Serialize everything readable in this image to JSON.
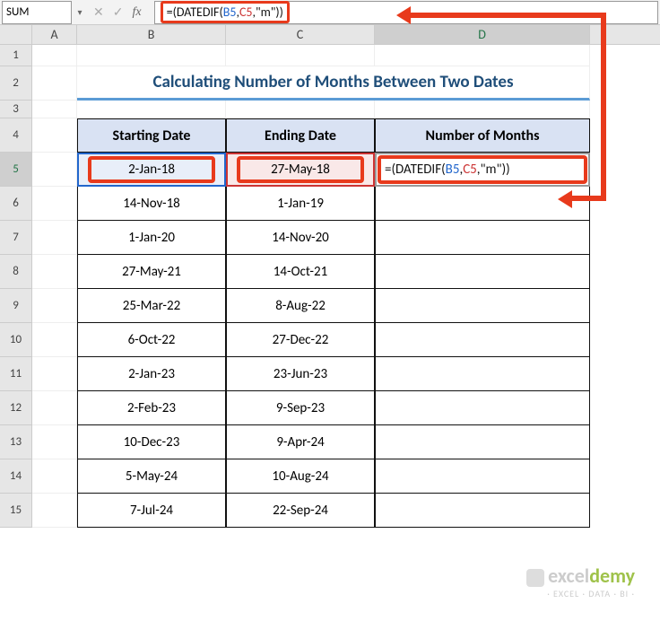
{
  "name_box": "SUM",
  "formula_bar": {
    "eq": "=",
    "p1": "(",
    "fn": "DATEDIF",
    "p2": "(",
    "ref1": "B5",
    "c1": ",",
    "ref2": "C5",
    "c2": ",",
    "str": "\"m\"",
    "p3": ")",
    "p4": ")"
  },
  "columns": [
    "A",
    "B",
    "C",
    "D"
  ],
  "title": "Calculating Number of Months Between Two Dates",
  "headers": {
    "b": "Starting Date",
    "c": "Ending Date",
    "d": "Number of Months"
  },
  "rows": [
    {
      "n": "5",
      "b": "2-Jan-18",
      "c": "27-May-18",
      "d_formula": {
        "eq": "=",
        "p1": "(",
        "fn": "DATEDIF",
        "p2": "(",
        "ref1": "B5",
        "c1": ",",
        "ref2": "C5",
        "c2": ",",
        "str": "\"m\"",
        "p3": ")",
        "p4": ")"
      }
    },
    {
      "n": "6",
      "b": "14-Nov-18",
      "c": "1-Jan-19"
    },
    {
      "n": "7",
      "b": "1-Jan-20",
      "c": "14-Nov-20"
    },
    {
      "n": "8",
      "b": "27-May-21",
      "c": "14-Oct-21"
    },
    {
      "n": "9",
      "b": "25-Mar-22",
      "c": "8-Aug-22"
    },
    {
      "n": "10",
      "b": "6-Oct-22",
      "c": "27-Dec-22"
    },
    {
      "n": "11",
      "b": "2-Jan-23",
      "c": "23-Jun-23"
    },
    {
      "n": "12",
      "b": "2-Feb-23",
      "c": "9-Sep-23"
    },
    {
      "n": "13",
      "b": "10-Dec-23",
      "c": "9-Apr-24"
    },
    {
      "n": "14",
      "b": "5-May-24",
      "c": "10-Aug-24"
    },
    {
      "n": "15",
      "b": "7-Jul-24",
      "c": "22-Sep-24"
    }
  ],
  "row_numbers_pre": [
    "1",
    "2",
    "3",
    "4"
  ],
  "watermark": {
    "brand_pre": "excel",
    "brand_post": "demy",
    "sub": "· EXCEL · DATA · BI ·"
  }
}
